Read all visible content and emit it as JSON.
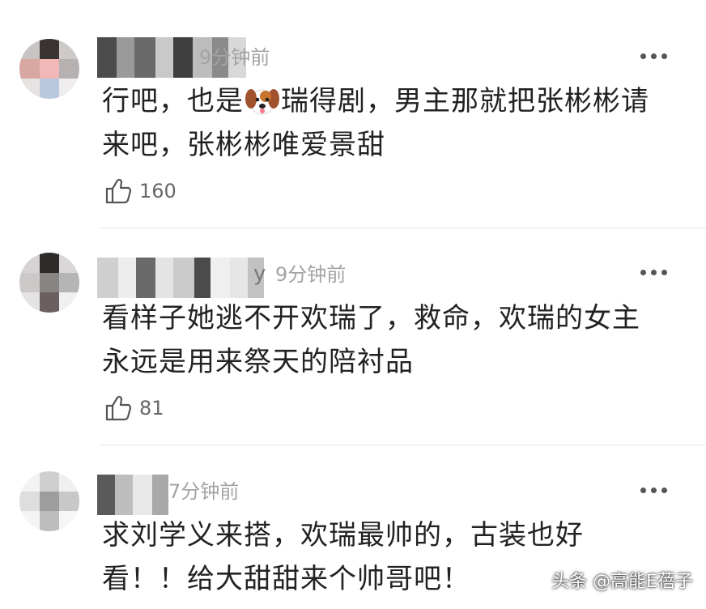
{
  "comments": [
    {
      "timestamp": "9分钟前",
      "text_line1_before": "行吧，也是",
      "emoji": "dog-face",
      "text_line1_after": "瑞得剧，男主那就把张彬彬请",
      "text_line2": "来吧，张彬彬唯爱景甜",
      "likes": "160"
    },
    {
      "timestamp": "9分钟前",
      "name_fragment": "y",
      "text_line1": "看样子她逃不开欢瑞了，救命，欢瑞的女主",
      "text_line2": "永远是用来祭天的陪衬品",
      "likes": "81"
    },
    {
      "timestamp": "7分钟前",
      "text_line1": "求刘学义来搭，欢瑞最帅的，古装也好",
      "text_line2": "看！！给大甜甜来个帅哥吧！"
    }
  ],
  "icons": {
    "more": "more-dots-icon",
    "like": "thumbs-up-icon"
  },
  "watermark": "头条 @高能E蓓子"
}
